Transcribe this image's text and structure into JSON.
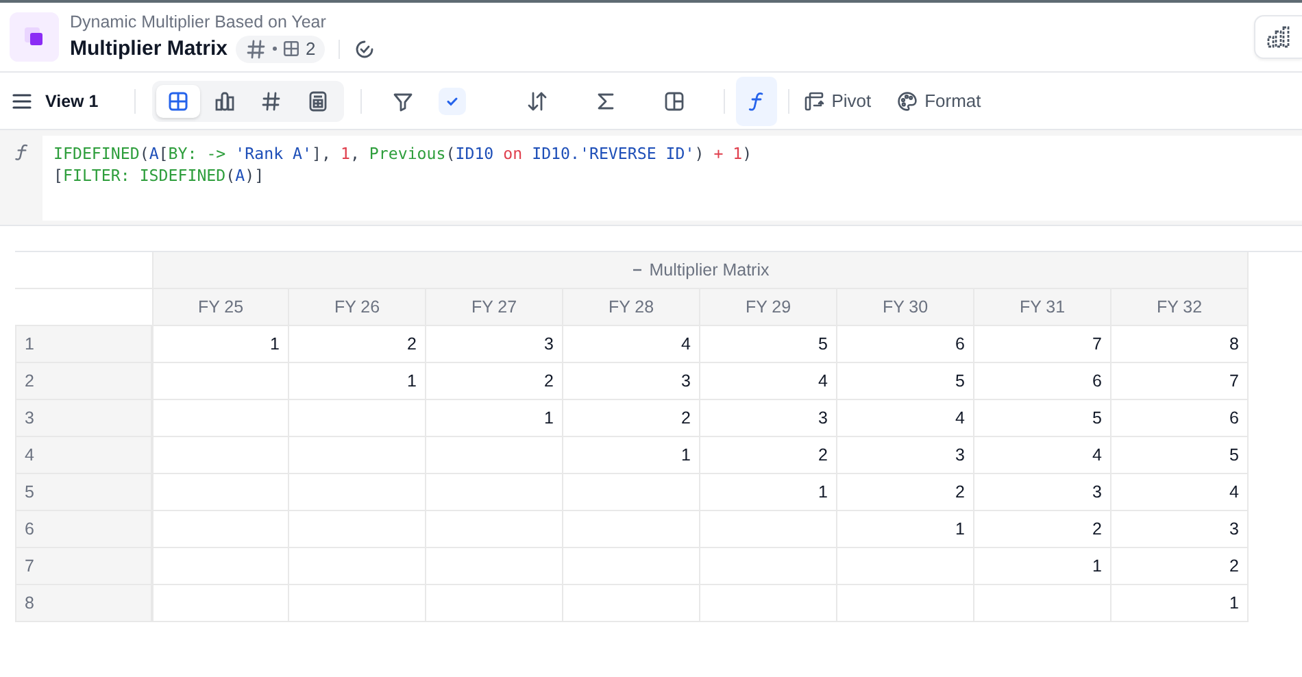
{
  "header": {
    "subtitle": "Dynamic Multiplier Based on Year",
    "title": "Multiplier Matrix",
    "badge_count": "2"
  },
  "toolbar": {
    "view": "View 1",
    "view_types": [
      {
        "kind": "table",
        "selected": true
      },
      {
        "kind": "chart",
        "selected": false
      },
      {
        "kind": "number",
        "selected": false
      },
      {
        "kind": "form",
        "selected": false
      }
    ],
    "tools": [
      {
        "kind": "filter",
        "active": false
      },
      {
        "kind": "check",
        "active": true
      },
      {
        "kind": "sort",
        "active": false
      },
      {
        "kind": "sum",
        "active": false
      },
      {
        "kind": "layout",
        "active": false
      },
      {
        "kind": "formula",
        "active": true
      }
    ],
    "actions": [
      {
        "kind": "pivot",
        "label": "Pivot"
      },
      {
        "kind": "format",
        "label": "Format"
      }
    ]
  },
  "formula": {
    "lines": [
      [
        {
          "kind": "func",
          "text": "IFDEFINED"
        },
        {
          "kind": "punct",
          "text": "("
        },
        {
          "kind": "ident",
          "text": "A"
        },
        {
          "kind": "punct",
          "text": "["
        },
        {
          "kind": "func",
          "text": "BY: -> "
        },
        {
          "kind": "string",
          "text": "'Rank A'"
        },
        {
          "kind": "punct",
          "text": "], "
        },
        {
          "kind": "number",
          "text": "1"
        },
        {
          "kind": "punct",
          "text": ", "
        },
        {
          "kind": "func",
          "text": "Previous"
        },
        {
          "kind": "punct",
          "text": "("
        },
        {
          "kind": "ident",
          "text": "ID10 "
        },
        {
          "kind": "keyword",
          "text": "on"
        },
        {
          "kind": "ident",
          "text": " ID10.'REVERSE ID'"
        },
        {
          "kind": "punct",
          "text": ") "
        },
        {
          "kind": "number",
          "text": "+ 1"
        },
        {
          "kind": "punct",
          "text": ")"
        }
      ],
      [
        {
          "kind": "punct",
          "text": "["
        },
        {
          "kind": "func",
          "text": "FILTER: ISDEFINED"
        },
        {
          "kind": "punct",
          "text": "("
        },
        {
          "kind": "ident",
          "text": "A"
        },
        {
          "kind": "punct",
          "text": ")]"
        }
      ]
    ]
  },
  "table": {
    "group": {
      "label": "Multiplier Matrix",
      "expanded": true
    },
    "columns": [
      "FY 25",
      "FY 26",
      "FY 27",
      "FY 28",
      "FY 29",
      "FY 30",
      "FY 31",
      "FY 32"
    ],
    "rows": [
      {
        "label": "1",
        "cells": [
          "1",
          "2",
          "3",
          "4",
          "5",
          "6",
          "7",
          "8"
        ]
      },
      {
        "label": "2",
        "cells": [
          null,
          "1",
          "2",
          "3",
          "4",
          "5",
          "6",
          "7"
        ]
      },
      {
        "label": "3",
        "cells": [
          null,
          null,
          "1",
          "2",
          "3",
          "4",
          "5",
          "6"
        ]
      },
      {
        "label": "4",
        "cells": [
          null,
          null,
          null,
          "1",
          "2",
          "3",
          "4",
          "5"
        ]
      },
      {
        "label": "5",
        "cells": [
          null,
          null,
          null,
          null,
          "1",
          "2",
          "3",
          "4"
        ]
      },
      {
        "label": "6",
        "cells": [
          null,
          null,
          null,
          null,
          null,
          "1",
          "2",
          "3"
        ]
      },
      {
        "label": "7",
        "cells": [
          null,
          null,
          null,
          null,
          null,
          null,
          "1",
          "2"
        ]
      },
      {
        "label": "8",
        "cells": [
          null,
          null,
          null,
          null,
          null,
          null,
          null,
          "1"
        ]
      }
    ]
  }
}
